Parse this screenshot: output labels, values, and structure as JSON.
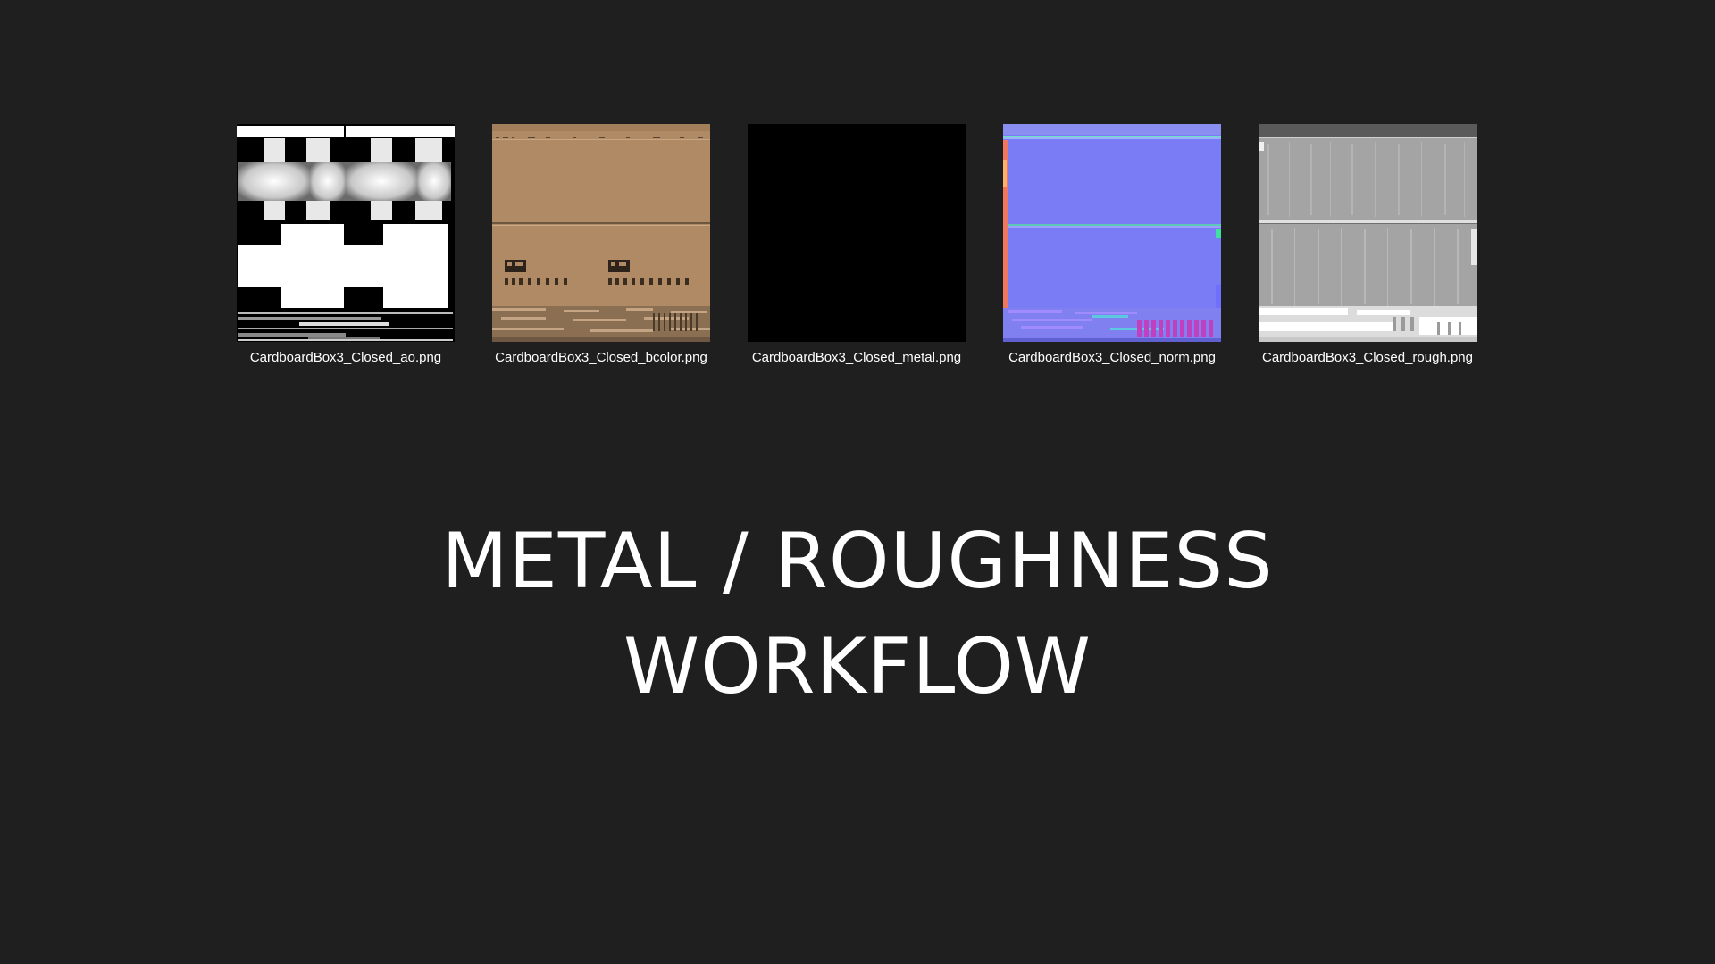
{
  "files": [
    {
      "name": "CardboardBox3_Closed_ao.png",
      "icon": "ao-texture-thumbnail"
    },
    {
      "name": "CardboardBox3_Closed_bcolor.png",
      "icon": "basecolor-texture-thumbnail"
    },
    {
      "name": "CardboardBox3_Closed_metal.png",
      "icon": "metal-texture-thumbnail"
    },
    {
      "name": "CardboardBox3_Closed_norm.png",
      "icon": "normal-texture-thumbnail"
    },
    {
      "name": "CardboardBox3_Closed_rough.png",
      "icon": "roughness-texture-thumbnail"
    }
  ],
  "headline": {
    "line1": "METAL / ROUGHNESS",
    "line2": "WORKFLOW"
  },
  "colors": {
    "background": "#1f1f1f",
    "text": "#ffffff",
    "cardboard": "#b08a64",
    "normal": "#7a7cf6"
  }
}
